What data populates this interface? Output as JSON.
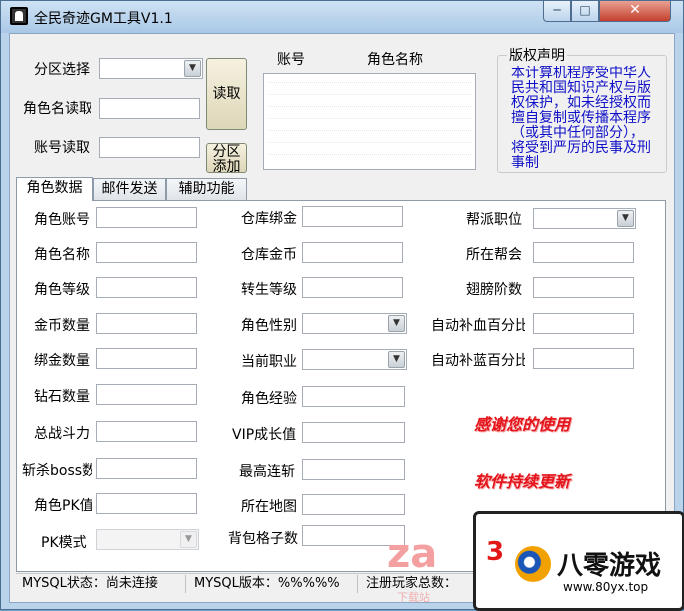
{
  "window": {
    "title": "全民奇迹GM工具V1.1",
    "close": "✕",
    "min": "─",
    "max": "□"
  },
  "top": {
    "server_label": "分区选择",
    "role_read_label": "角色名读取",
    "account_read_label": "账号读取",
    "read_button": "读取",
    "add_server_button": "分区添加",
    "list_headers": [
      "账号",
      "角色名称"
    ]
  },
  "copyright": {
    "title": "版权声明",
    "text": "本计算机程序受中华人民共和国知识产权与版权保护，如未经授权而擅自复制或传播本程序（或其中任何部分），将受到严厉的民事及刑事制"
  },
  "tabs": [
    "角色数据",
    "邮件发送",
    "辅助功能"
  ],
  "fields_left": [
    "角色账号",
    "角色名称",
    "角色等级",
    "金币数量",
    "绑金数量",
    "钻石数量",
    "总战斗力",
    "斩杀boss数",
    "角色PK值",
    "PK模式"
  ],
  "fields_mid": [
    "仓库绑金",
    "仓库金币",
    "转生等级",
    "角色性别",
    "当前职业",
    "角色经验",
    "VIP成长值",
    "最高连斩",
    "所在地图",
    "背包格子数"
  ],
  "fields_right": [
    "帮派职位",
    "所在帮会",
    "翅膀阶数",
    "自动补血百分比",
    "自动补蓝百分比"
  ],
  "slogans": [
    "感谢您的使用",
    "软件持续更新"
  ],
  "status": {
    "mysql_state": "MYSQL状态：尚未连接",
    "mysql_version": "MYSQL版本：%%%%%",
    "players": "注册玩家总数："
  },
  "watermark": {
    "site": "八零游戏",
    "url": "www.80yx.top",
    "overlay": "za",
    "overlay_sub": "下载站",
    "mark": "3"
  }
}
